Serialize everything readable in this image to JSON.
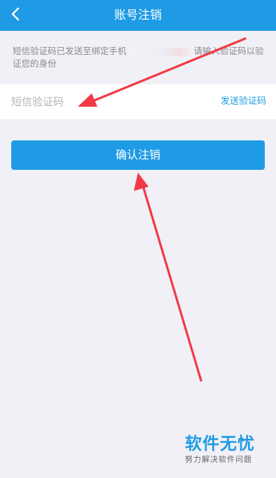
{
  "header": {
    "title": "账号注销",
    "back_icon": "chevron-left-icon"
  },
  "hint": {
    "text_before": "短信验证码已发送至绑定手机",
    "text_after": "请输入验证码以验证您的身份"
  },
  "verification": {
    "placeholder": "短信验证码",
    "value": "",
    "send_code_label": "发送验证码"
  },
  "confirm_button": {
    "label": "确认注销"
  },
  "watermark": {
    "title": "软件无忧",
    "subtitle": "努力解决软件问题"
  },
  "colors": {
    "accent": "#1f9be5",
    "background": "#f0f0f6",
    "annotation_arrow": "#f03a45"
  }
}
